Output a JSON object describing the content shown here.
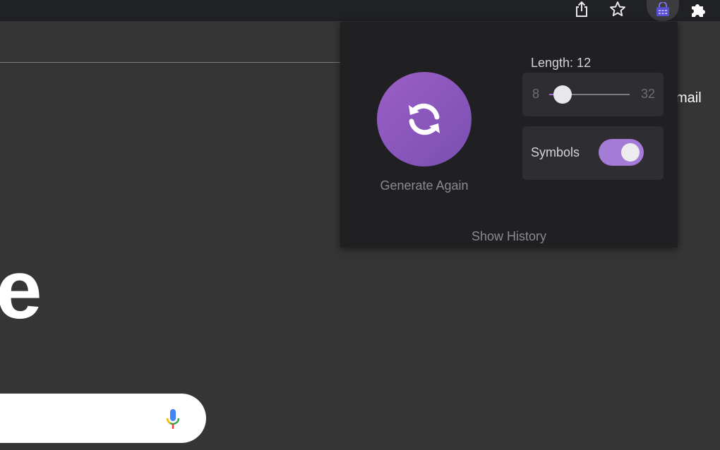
{
  "toolbar": {
    "icons": [
      "share-icon",
      "star-icon",
      "password-generator-extension-icon",
      "puzzle-icon"
    ]
  },
  "page": {
    "gmail_link": "mail",
    "logo_fragment": "e"
  },
  "popup": {
    "generate_label": "Generate Again",
    "length_label": "Length: 12",
    "slider": {
      "min": "8",
      "max": "32",
      "value": 12
    },
    "symbols_label": "Symbols",
    "symbols_enabled": true,
    "history_link": "Show History",
    "accent_color": "#9b5fc8"
  }
}
